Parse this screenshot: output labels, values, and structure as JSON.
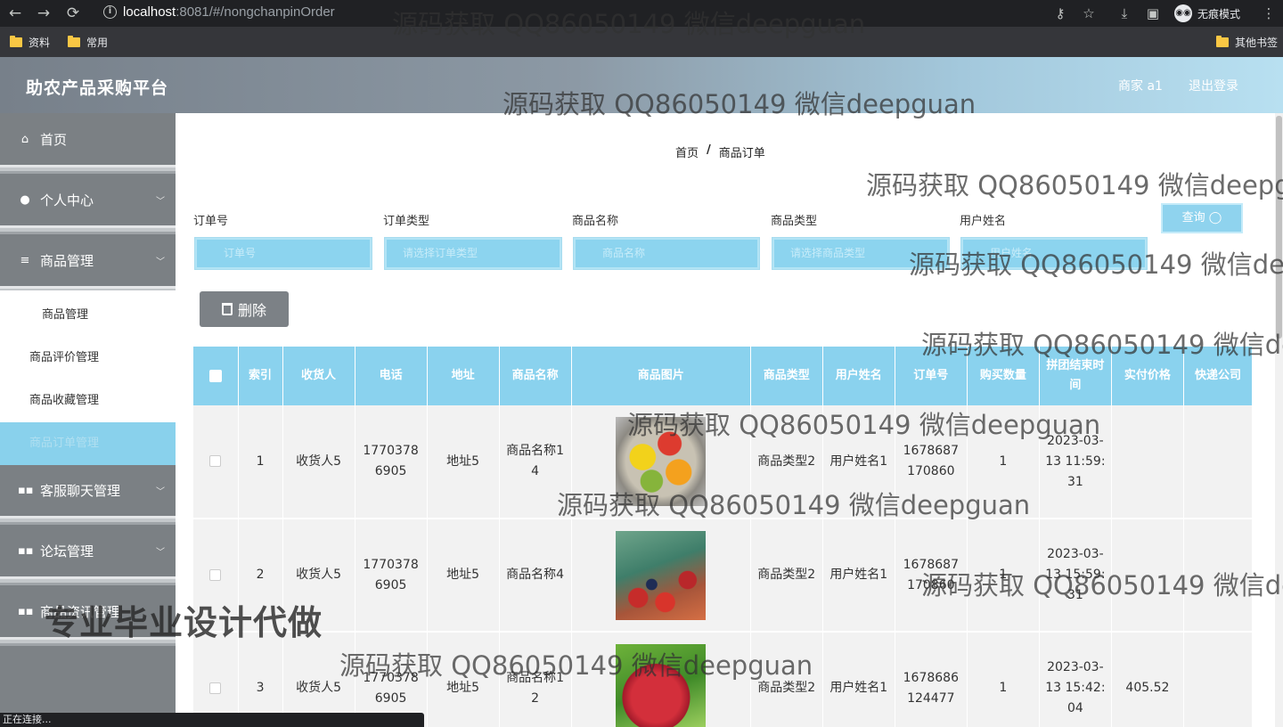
{
  "browser": {
    "url_host": "localhost",
    "url_rest": ":8081/#/nongchanpinOrder",
    "incognito_label": "无痕模式",
    "bookmarks": [
      "资料",
      "常用"
    ],
    "other_bookmarks": "其他书签",
    "status_text": "正在连接..."
  },
  "header": {
    "title": "助农产品采购平台",
    "user": "商家 a1",
    "logout": "退出登录"
  },
  "sidebar": {
    "items": [
      {
        "label": "首页",
        "icon": "home-icon"
      },
      {
        "label": "个人中心",
        "icon": "user-icon"
      },
      {
        "label": "商品管理",
        "icon": "menu-icon"
      },
      {
        "label": "客服聊天管理",
        "icon": "grid-icon"
      },
      {
        "label": "论坛管理",
        "icon": "grid-icon"
      },
      {
        "label": "商品资讯管理",
        "icon": "grid-icon"
      }
    ],
    "submenu": [
      {
        "label": "商品管理"
      },
      {
        "label": "商品评价管理"
      },
      {
        "label": "商品收藏管理"
      },
      {
        "label": "商品订单管理"
      }
    ]
  },
  "breadcrumb": {
    "home": "首页",
    "separator": "/",
    "current": "商品订单"
  },
  "filters": {
    "labels": [
      "订单号",
      "订单类型",
      "商品名称",
      "商品类型",
      "用户姓名"
    ],
    "placeholders": [
      "订单号",
      "请选择订单类型",
      "商品名称",
      "请选择商品类型",
      "用户姓名"
    ],
    "search_label": "查询 ◯"
  },
  "actions": {
    "delete_label": "删除"
  },
  "table": {
    "headers": [
      "索引",
      "收货人",
      "电话",
      "地址",
      "商品名称",
      "商品图片",
      "商品类型",
      "用户姓名",
      "订单号",
      "购买数量",
      "拼团结束时间",
      "实付价格",
      "快递公司"
    ],
    "rows": [
      {
        "index": "1",
        "receiver": "收货人5",
        "phone": "17703786905",
        "address": "地址5",
        "product": "商品名称14",
        "image": "fruit-basket",
        "type": "商品类型2",
        "user": "用户姓名1",
        "order_no": "1678687170860",
        "qty": "1",
        "end_time": "2023-03-13 11:59:31",
        "price": "",
        "courier": ""
      },
      {
        "index": "2",
        "receiver": "收货人5",
        "phone": "17703786905",
        "address": "地址5",
        "product": "商品名称4",
        "image": "berries",
        "type": "商品类型2",
        "user": "用户姓名1",
        "order_no": "1678687170860",
        "qty": "1",
        "end_time": "2023-03-13 15:59:31",
        "price": "",
        "courier": ""
      },
      {
        "index": "3",
        "receiver": "收货人5",
        "phone": "17703786905",
        "address": "地址5",
        "product": "商品名称12",
        "image": "apple",
        "type": "商品类型2",
        "user": "用户姓名1",
        "order_no": "1678686124477",
        "qty": "1",
        "end_time": "2023-03-13 15:42:04",
        "price": "405.52",
        "courier": ""
      }
    ]
  },
  "overlays": {
    "watermark": "源码获取 QQ86050149 微信deepguan",
    "promo": "专业毕业设计代做"
  }
}
